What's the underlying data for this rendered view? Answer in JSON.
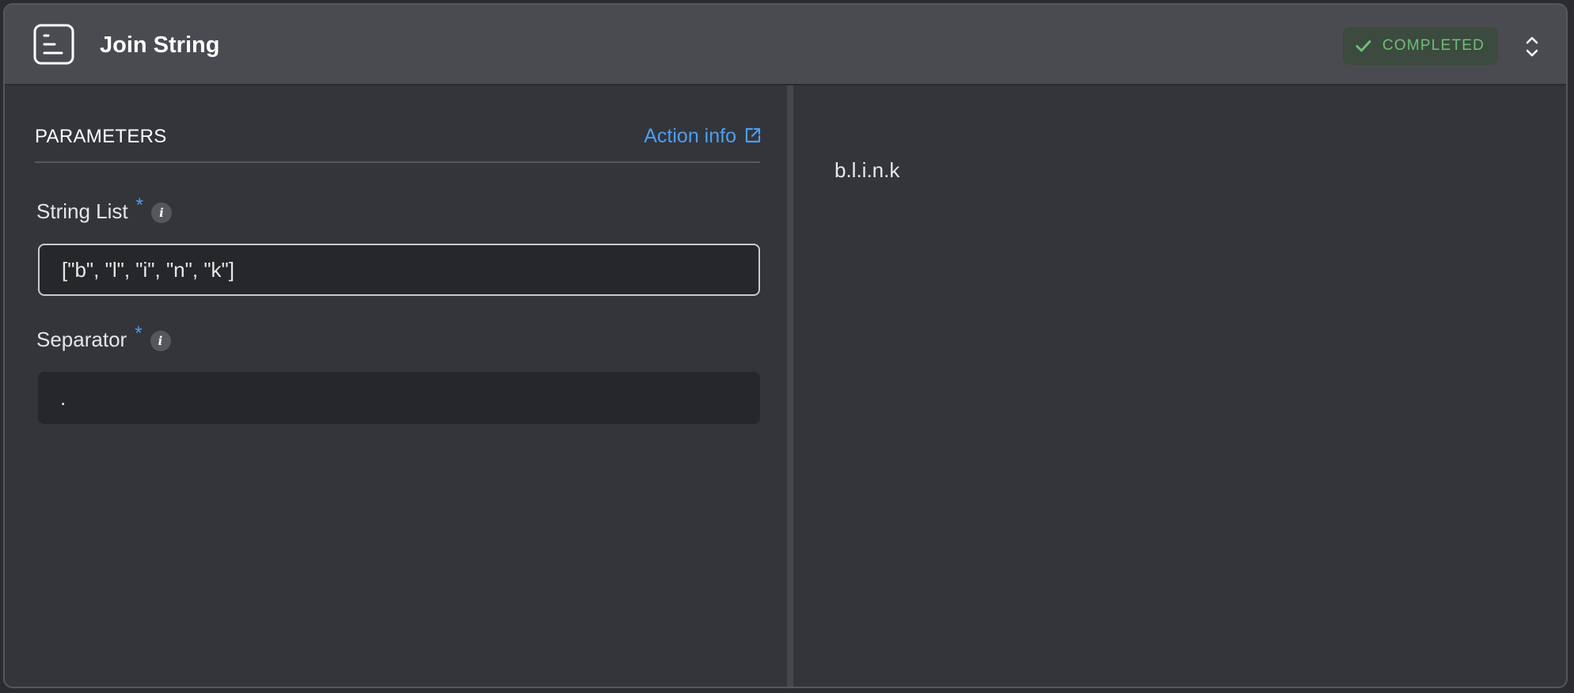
{
  "header": {
    "icon": "document-lines-icon",
    "title": "Join String",
    "status": "COMPLETED",
    "status_color": "#6fbf73"
  },
  "parameters": {
    "section_title": "PARAMETERS",
    "action_info_label": "Action info",
    "fields": [
      {
        "label": "String List",
        "required_mark": "*",
        "value": "[\"b\", \"l\", \"i\", \"n\", \"k\"]"
      },
      {
        "label": "Separator",
        "required_mark": "*",
        "value": "."
      }
    ]
  },
  "output": {
    "value": "b.l.i.n.k"
  },
  "colors": {
    "accent": "#4b9ff0",
    "background": "#34353a",
    "header_background": "#4a4b50"
  }
}
